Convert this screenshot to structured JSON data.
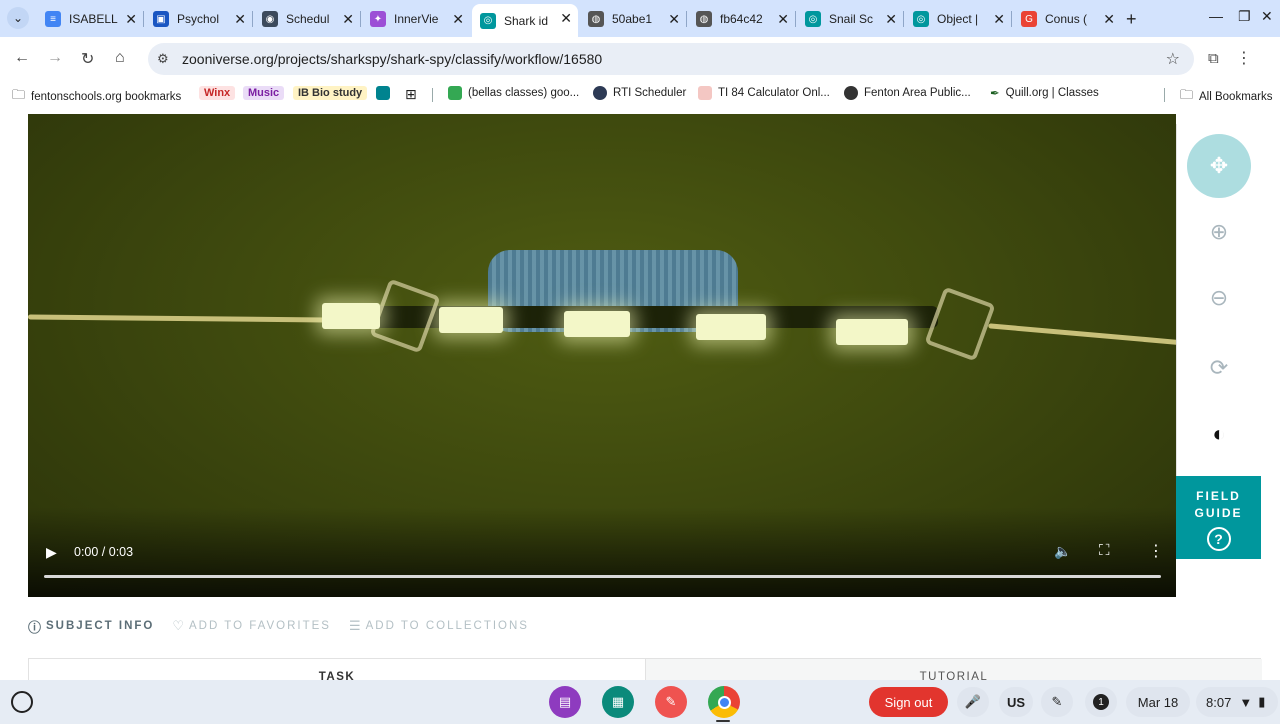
{
  "tabs": [
    {
      "title": "ISABELL",
      "color": "#4285f4",
      "glyph": "≡"
    },
    {
      "title": "Psychol",
      "color": "#1a56c2",
      "glyph": "▣"
    },
    {
      "title": "Schedul",
      "color": "#3c4a5c",
      "glyph": "◉"
    },
    {
      "title": "InnerVie",
      "color": "#9c4fd6",
      "glyph": "✦"
    },
    {
      "title": "Shark id",
      "color": "#00979d",
      "glyph": "◎"
    },
    {
      "title": "50abe1",
      "color": "#555",
      "glyph": "◍"
    },
    {
      "title": "fb64c42",
      "color": "#555",
      "glyph": "◍"
    },
    {
      "title": "Snail Sc",
      "color": "#00979d",
      "glyph": "◎"
    },
    {
      "title": "Object |",
      "color": "#00979d",
      "glyph": "◎"
    },
    {
      "title": "Conus (",
      "color": "#ea4335",
      "glyph": "G"
    }
  ],
  "active_tab_index": 4,
  "tab_close_glyph": "✕",
  "new_tab_glyph": "+",
  "url": "zooniverse.org/projects/sharkspy/shark-spy/classify/workflow/16580",
  "bookmarks": {
    "folder": "fentonschools.org bookmarks",
    "winx": "Winx",
    "music": "Music",
    "ib_bio": "IB Bio study",
    "bellas": "(bellas classes) goo...",
    "rti": "RTI Scheduler",
    "ti84": "TI 84 Calculator Onl...",
    "fenton": "Fenton Area Public...",
    "quill": "Quill.org | Classes",
    "all": "All Bookmarks"
  },
  "video": {
    "time": "0:00 / 0:03",
    "progress": 0
  },
  "tools": [
    {
      "name": "move-tool",
      "glyph": "✥",
      "active": true
    },
    {
      "name": "zoom-in-tool",
      "glyph": "⊕",
      "active": false
    },
    {
      "name": "zoom-out-tool",
      "glyph": "⊖",
      "active": false
    },
    {
      "name": "rotate-tool",
      "glyph": "⟳",
      "active": false
    },
    {
      "name": "invert-tool",
      "glyph": "◐",
      "active": false
    }
  ],
  "field_guide": {
    "line1": "FIELD",
    "line2": "GUIDE",
    "q": "?"
  },
  "subject_bar": {
    "info": "SUBJECT INFO",
    "favorites": "ADD TO FAVORITES",
    "collections": "ADD TO COLLECTIONS"
  },
  "tabs_panel": {
    "task": "TASK",
    "tutorial": "TUTORIAL"
  },
  "shelf": {
    "sign_out": "Sign out",
    "lang": "US",
    "notif": "1",
    "date": "Mar 18",
    "time": "8:07"
  }
}
